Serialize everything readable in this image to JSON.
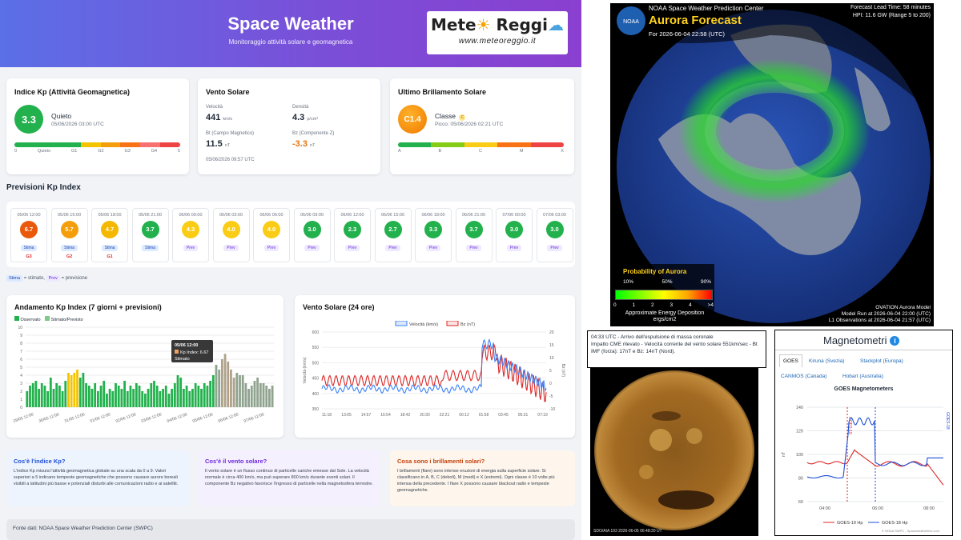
{
  "header": {
    "title": "Space Weather",
    "subtitle": "Monitoraggio attività solare e geomagnetica"
  },
  "logo": {
    "brand_a": "Mete",
    "brand_b": "Reggi",
    "url": "www.meteoreggio.it"
  },
  "kp_card": {
    "title": "Indice Kp (Attività Geomagnetica)",
    "value": "3.3",
    "state": "Quieto",
    "time": "05/06/2026 03:00 UTC",
    "scale_labels": [
      "0",
      "Quieto",
      "G1",
      "G2",
      "G3",
      "G4",
      "5"
    ]
  },
  "wind_card": {
    "title": "Vento Solare",
    "speed_label": "Velocità",
    "speed": "441",
    "speed_unit": "km/s",
    "density_label": "Densità",
    "density": "4.3",
    "density_unit": "p/cm³",
    "bt_label": "Bt (Campo Magnetico)",
    "bt": "11.5",
    "bt_unit": "nT",
    "bz_label": "Bz (Componente Z)",
    "bz": "-3.3",
    "bz_unit": "nT",
    "time": "05/06/2026 09:57 UTC"
  },
  "flare_card": {
    "title": "Ultimo Brillamento Solare",
    "value": "C1.4",
    "class_label": "Classe",
    "class_letter": "C",
    "peak": "Picco: 05/06/2026 02:21 UTC",
    "scale_labels": [
      "A",
      "B",
      "C",
      "M",
      "X"
    ]
  },
  "forecast": {
    "title": "Previsioni Kp Index",
    "items": [
      {
        "date": "05/06 12:00",
        "kp": "6.7",
        "tag": "Stima",
        "g": "G3",
        "color": "#ea580c"
      },
      {
        "date": "05/06 15:00",
        "kp": "5.7",
        "tag": "Stima",
        "g": "G2",
        "color": "#f59e0b"
      },
      {
        "date": "05/06 18:00",
        "kp": "4.7",
        "tag": "Stima",
        "g": "G1",
        "color": "#f5b800"
      },
      {
        "date": "05/06 21:00",
        "kp": "3.7",
        "tag": "Stima",
        "g": "",
        "color": "#22b14c"
      },
      {
        "date": "06/06 00:00",
        "kp": "4.3",
        "tag": "Prev",
        "g": "",
        "color": "#facc15"
      },
      {
        "date": "06/06 03:00",
        "kp": "4.0",
        "tag": "Prev",
        "g": "",
        "color": "#facc15"
      },
      {
        "date": "06/06 06:00",
        "kp": "4.0",
        "tag": "Prev",
        "g": "",
        "color": "#facc15"
      },
      {
        "date": "06/06 09:00",
        "kp": "3.0",
        "tag": "Prev",
        "g": "",
        "color": "#22b14c"
      },
      {
        "date": "06/06 12:00",
        "kp": "2.3",
        "tag": "Prev",
        "g": "",
        "color": "#22b14c"
      },
      {
        "date": "06/06 15:00",
        "kp": "2.7",
        "tag": "Prev",
        "g": "",
        "color": "#22b14c"
      },
      {
        "date": "06/06 18:00",
        "kp": "3.3",
        "tag": "Prev",
        "g": "",
        "color": "#22b14c"
      },
      {
        "date": "06/06 21:00",
        "kp": "3.7",
        "tag": "Prev",
        "g": "",
        "color": "#22b14c"
      },
      {
        "date": "07/06 00:00",
        "kp": "3.0",
        "tag": "Prev",
        "g": "",
        "color": "#22b14c"
      },
      {
        "date": "07/06 03:00",
        "kp": "3.0",
        "tag": "Prev",
        "g": "",
        "color": "#22b14c"
      }
    ],
    "legend_stima": "Stima",
    "legend_stima_text": "= stimato,",
    "legend_prev": "Prev",
    "legend_prev_text": "= previsione"
  },
  "kp_chart": {
    "title": "Andamento Kp Index (7 giorni + previsioni)",
    "legend_obs": "Osservato",
    "legend_est": "Stimato/Previsto",
    "y_ticks": [
      "0",
      "1",
      "2",
      "3",
      "4",
      "5",
      "6",
      "7",
      "8",
      "9",
      "10"
    ],
    "x_ticks": [
      "29/05 12:00",
      "30/05 12:00",
      "31/05 12:00",
      "01/06 12:00",
      "02/06 12:00",
      "03/06 12:00",
      "04/06 12:00",
      "05/06 12:00",
      "06/06 12:00",
      "07/06 12:00"
    ],
    "tooltip_time": "05/06 12:00",
    "tooltip_value": "Kp Index: 6.67",
    "tooltip_tag": "Stimato"
  },
  "wind_chart": {
    "title": "Vento Solare (24 ore)",
    "legend_speed": "Velocità (km/s)",
    "legend_bz": "Bz (nT)",
    "y_left": [
      "350",
      "400",
      "450",
      "500",
      "550",
      "600"
    ],
    "y_right": [
      "-10",
      "-5",
      "0",
      "5",
      "10",
      "15",
      "20"
    ],
    "ylabel_left": "Velocità (km/s)",
    "ylabel_right": "Bz (nT)",
    "x_ticks": [
      "11:18",
      "13:05",
      "14:57",
      "16:54",
      "18:42",
      "20:30",
      "22:21",
      "00:12",
      "01:58",
      "03:45",
      "05:31",
      "07:19"
    ]
  },
  "info": [
    {
      "title": "Cos'è l'indice Kp?",
      "text": "L'indice Kp misura l'attività geomagnetica globale su una scala da 0 a 9. Valori superiori a 5 indicano tempeste geomagnetiche che possono causare aurore boreali visibili a latitudini più basse e potenziali disturbi alle comunicazioni radio e ai satelliti."
    },
    {
      "title": "Cos'è il vento solare?",
      "text": "Il vento solare è un flusso continuo di particelle cariche emesse dal Sole. La velocità normale è circa 400 km/s, ma può superare 800 km/s durante eventi solari. Il componente Bz negativo favorisce l'ingresso di particelle nella magnetosfera terrestre."
    },
    {
      "title": "Cosa sono i brillamenti solari?",
      "text": "I brillamenti (flare) sono intense eruzioni di energia sulla superficie solare. Si classificano in A, B, C (deboli), M (medi) e X (estremi). Ogni classe è 10 volte più intensa della precedente. I flare X possono causare blackout radio e tempeste geomagnetiche."
    }
  ],
  "footer": "Fonte dati: NOAA Space Weather Prediction Center (SWPC)",
  "aurora": {
    "t1": "NOAA Space Weather Prediction Center",
    "title": "Aurora Forecast",
    "for": "For 2026-06-04 22:58 (UTC)",
    "lead": "Forecast Lead Time:  58 minutes",
    "hpi": "HPI:  11.6 GW (Range 5 to 200)",
    "prob": "Probability of Aurora",
    "pticks": [
      "10%",
      "50%",
      "90%"
    ],
    "nums": [
      "0",
      "1",
      "2",
      "3",
      "4",
      ">4"
    ],
    "energy": "Approximate Energy Deposition",
    "energy_unit": "ergs/cm2",
    "model": "OVATION Aurora Model",
    "run": "Model Run at 2026-06-04 22:00 (UTC)",
    "obs": "L1 Observations at 2026-06-04 21:57 (UTC)",
    "noaa": "NOAA"
  },
  "cme": {
    "line1": "04:33 UTC - Arrivo dell'espulsione di massa coronale",
    "line2": "Impatto CME rilevato - Velocità corrente del vento solare 551km/sec - Bt IMF (forza): 17nT e Bz: 14nT (Nord).",
    "sun_caption": "SDO/AIA 193    2026-06-05 06:48:20 UT"
  },
  "mag": {
    "title": "Magnetometri",
    "tabs": [
      "GOES",
      "Kiruna (Svezia)",
      "Stackplot (Europa)",
      "CANMOS (Canada)",
      "Hobart (Australia)"
    ],
    "chart_title": "GOES Magnetometers",
    "y_ticks": [
      "60",
      "80",
      "100",
      "120",
      "140"
    ],
    "ylabel": "nT",
    "x_ticks": [
      "04:00",
      "06:00",
      "08:00"
    ],
    "legend": [
      "GOES-19 Hp",
      "GOES-18 Hp"
    ],
    "credit": "© NOAA SWPC - Spaceweatherlive.com",
    "mark_left": "GOES-19",
    "mark_right": "GOES-18"
  }
}
